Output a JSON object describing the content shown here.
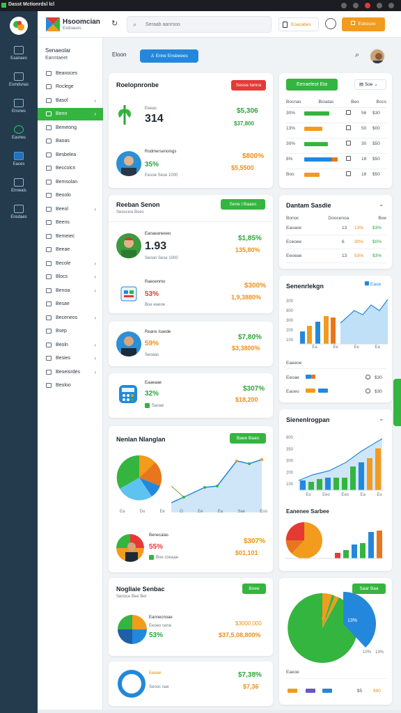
{
  "titlebar": {
    "title": "Dasst Mctionrdsl lcl"
  },
  "rail": {
    "items": [
      {
        "label": "Eaanaes"
      },
      {
        "label": "Esmdsnas"
      },
      {
        "label": "Ensnes"
      },
      {
        "label": "Eashes"
      },
      {
        "label": "Eaces"
      },
      {
        "label": "Enneals"
      },
      {
        "label": "Ensdaes"
      }
    ]
  },
  "header": {
    "brand": "Hsoomcian",
    "brand_sub": "Exdoaues",
    "search_placeholder": "Seraab aanrsoo",
    "pill_label": "Eoacabes",
    "button_label": "Esbosee"
  },
  "sidebar": {
    "title": "Senaeolar",
    "subtitle": "Eanntaeet",
    "items": [
      {
        "label": "Beanoces",
        "chevron": ""
      },
      {
        "label": "Roclege",
        "chevron": ""
      },
      {
        "label": "Basol",
        "chevron": "›"
      },
      {
        "label": "Benn",
        "chevron": "›",
        "active": true
      },
      {
        "label": "Bemeong",
        "chevron": ""
      },
      {
        "label": "Baoas",
        "chevron": ""
      },
      {
        "label": "Besbelea",
        "chevron": ""
      },
      {
        "label": "Beccolcn",
        "chevron": ""
      },
      {
        "label": "Bemsolan",
        "chevron": ""
      },
      {
        "label": "Beoolo",
        "chevron": ""
      },
      {
        "label": "Beeol",
        "chevron": "›"
      },
      {
        "label": "Beens",
        "chevron": ""
      },
      {
        "label": "Bemeiec",
        "chevron": ""
      },
      {
        "label": "Beeae",
        "chevron": ""
      },
      {
        "label": "Becole",
        "chevron": "›"
      },
      {
        "label": "Blocs",
        "chevron": "›"
      },
      {
        "label": "Benoa",
        "chevron": "›"
      },
      {
        "label": "Besae",
        "chevron": ""
      },
      {
        "label": "Beceneos",
        "chevron": "›"
      },
      {
        "label": "Bsep",
        "chevron": ""
      },
      {
        "label": "Beoln",
        "chevron": "›"
      },
      {
        "label": "Besies",
        "chevron": "›"
      },
      {
        "label": "Beoeisrdes",
        "chevron": "›"
      },
      {
        "label": "Beoloo",
        "chevron": ""
      }
    ]
  },
  "toolbar": {
    "left_label": "Eloon",
    "action_label": "Enne Ensbeees"
  },
  "card1": {
    "title": "Roelopnronbe",
    "badge": "Sesse tanna",
    "a": {
      "label": "Eeeas",
      "value": "314",
      "right1": "$5,306",
      "right2": "$37,800"
    },
    "b": {
      "label": "Rodmersenoings",
      "pct": "35%",
      "meta": "Eesoe Sese 1000",
      "right1": "$800%",
      "right2": "$5,5500"
    }
  },
  "card2": {
    "title": "Reeban Senon",
    "subtitle": "Seoscesi Boes",
    "badge": "Sene l Baaes",
    "a": {
      "label": "Eanaeaneeeo",
      "value": "1.93",
      "meta": "Senon Sese 1000",
      "right1": "$1,85%",
      "right2": "135,80%"
    },
    "b": {
      "label": "Raeoenmo",
      "pct": "53%",
      "meta": "Boe eaeoe",
      "right1": "$300%",
      "right2": "1,9,3880%"
    }
  },
  "card3": {
    "label": "Reane Isaede",
    "pct": "59%",
    "meta": "Seoaas",
    "right1": "$7,80%",
    "right2": "$3,3800%"
  },
  "card4": {
    "label": "Eaaeaae",
    "pct": "32%",
    "meta": "Saoae",
    "right1": "$307%",
    "right2": "$18,200"
  },
  "card5": {
    "title": "Nenlan Nlanglan",
    "badge": "Baee Baan",
    "axis": [
      "Ea",
      "Do",
      "Ee",
      "O",
      "Ee",
      "Ea",
      "Sae",
      "Eoo"
    ],
    "sub": {
      "label": "Benecalas",
      "pct": "55%",
      "meta": "Boe coeaae",
      "right1": "$307%",
      "right2": "$01,101"
    }
  },
  "card6": {
    "title": "Nogliaie Senbac",
    "subtitle": "Senoce Bee Bel",
    "badge": "Boee",
    "a": {
      "label": "Eannecnoae",
      "pct": "53%",
      "meta": "Eeoeo cene",
      "right1": "$3000,000",
      "right2": "$37,5,08,800%"
    },
    "b": {
      "label": "Eeeae",
      "meta": "Senoc nae",
      "right1": "$7,38%",
      "right2": "$7,36"
    }
  },
  "r1": {
    "title": "Eenaeleot Eta",
    "select": "Soe",
    "cols": [
      "Bocnas",
      "Bioatas",
      "Beo",
      "Bocs"
    ],
    "rows": [
      {
        "a": "30%",
        "v1": "56",
        "v2": "$30"
      },
      {
        "a": "13%",
        "v1": "50",
        "v2": "$00"
      },
      {
        "a": "30%",
        "v1": "30",
        "v2": "$50"
      },
      {
        "a": "8%",
        "v1": "18",
        "v2": "$50"
      },
      {
        "a": "Boo",
        "v1": "18",
        "v2": "$50"
      }
    ]
  },
  "r2": {
    "title": "Dantam Sasdie",
    "cols": [
      "Bonoc",
      "Doocenoa",
      "Boe"
    ],
    "rows": [
      {
        "a": "Eaoase",
        "b": "13",
        "c": "13%",
        "d": "$3%"
      },
      {
        "a": "Eceoee",
        "b": "6",
        "c": "30%",
        "d": "$0%"
      },
      {
        "a": "Eeoeae",
        "b": "13",
        "c": "53%",
        "d": "$3%"
      }
    ]
  },
  "r3": {
    "title": "Senenrlekgn",
    "badge": "Eaoe",
    "axis": [
      "300",
      "800",
      "300",
      "200",
      "100"
    ],
    "xaxis": [
      "Ea",
      "Ee",
      "Ee",
      "Ea"
    ],
    "footer": "Eaeeoe",
    "rows": [
      {
        "a": "Eeoae",
        "v": "$30"
      },
      {
        "a": "Eaoeo",
        "v": "$30"
      }
    ]
  },
  "r4": {
    "title": "Sienenlrogpan",
    "axis": [
      "800",
      "350",
      "300",
      "200",
      "100"
    ],
    "sub": "Eanenee Sarbee",
    "xaxis": [
      "Eo",
      "Eeo",
      "Eeo",
      "Ea",
      "Eo"
    ],
    "colors": {
      "bar1": "#34b53f",
      "bar2": "#f29b1c",
      "bar3": "#2388dc"
    }
  },
  "r5": {
    "badge": "Saar Baa",
    "pct1": "13%",
    "pct2": "10%",
    "pct3": "13%",
    "legend": "Eaeoe",
    "v1": "$5",
    "v2": "$90"
  }
}
